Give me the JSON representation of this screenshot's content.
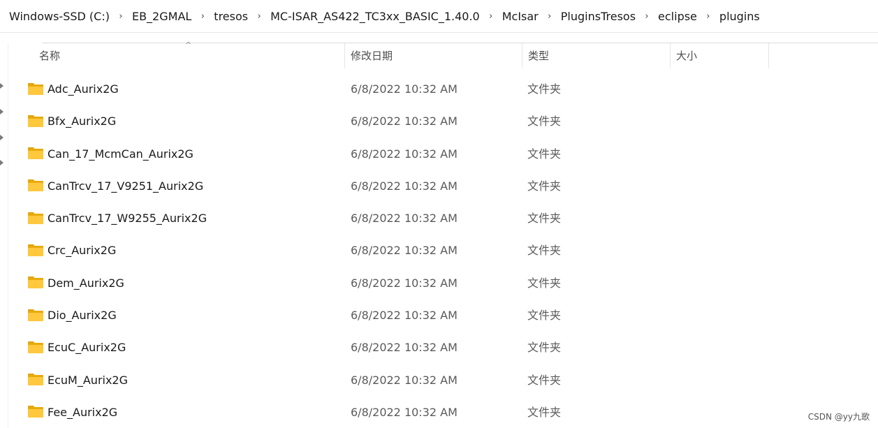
{
  "breadcrumb": [
    "Windows-SSD (C:)",
    "EB_2GMAL",
    "tresos",
    "MC-ISAR_AS422_TC3xx_BASIC_1.40.0",
    "McIsar",
    "PluginsTresos",
    "eclipse",
    "plugins"
  ],
  "breadcrumb_separator": "›",
  "columns": {
    "name": "名称",
    "date": "修改日期",
    "type": "类型",
    "size": "大小"
  },
  "sort_indicator": "^",
  "files": [
    {
      "name": "Adc_Aurix2G",
      "date": "6/8/2022 10:32 AM",
      "type": "文件夹"
    },
    {
      "name": "Bfx_Aurix2G",
      "date": "6/8/2022 10:32 AM",
      "type": "文件夹"
    },
    {
      "name": "Can_17_McmCan_Aurix2G",
      "date": "6/8/2022 10:32 AM",
      "type": "文件夹"
    },
    {
      "name": "CanTrcv_17_V9251_Aurix2G",
      "date": "6/8/2022 10:32 AM",
      "type": "文件夹"
    },
    {
      "name": "CanTrcv_17_W9255_Aurix2G",
      "date": "6/8/2022 10:32 AM",
      "type": "文件夹"
    },
    {
      "name": "Crc_Aurix2G",
      "date": "6/8/2022 10:32 AM",
      "type": "文件夹"
    },
    {
      "name": "Dem_Aurix2G",
      "date": "6/8/2022 10:32 AM",
      "type": "文件夹"
    },
    {
      "name": "Dio_Aurix2G",
      "date": "6/8/2022 10:32 AM",
      "type": "文件夹"
    },
    {
      "name": "EcuC_Aurix2G",
      "date": "6/8/2022 10:32 AM",
      "type": "文件夹"
    },
    {
      "name": "EcuM_Aurix2G",
      "date": "6/8/2022 10:32 AM",
      "type": "文件夹"
    },
    {
      "name": "Fee_Aurix2G",
      "date": "6/8/2022 10:32 AM",
      "type": "文件夹"
    }
  ],
  "watermark": "CSDN @yy九歌",
  "colors": {
    "folder": "#ffc83d",
    "folder_back": "#e8ab0c",
    "header_text": "#4d4d4d"
  },
  "icons": {
    "folder": "folder-icon",
    "nav_expand": "chevron-right-icon"
  }
}
